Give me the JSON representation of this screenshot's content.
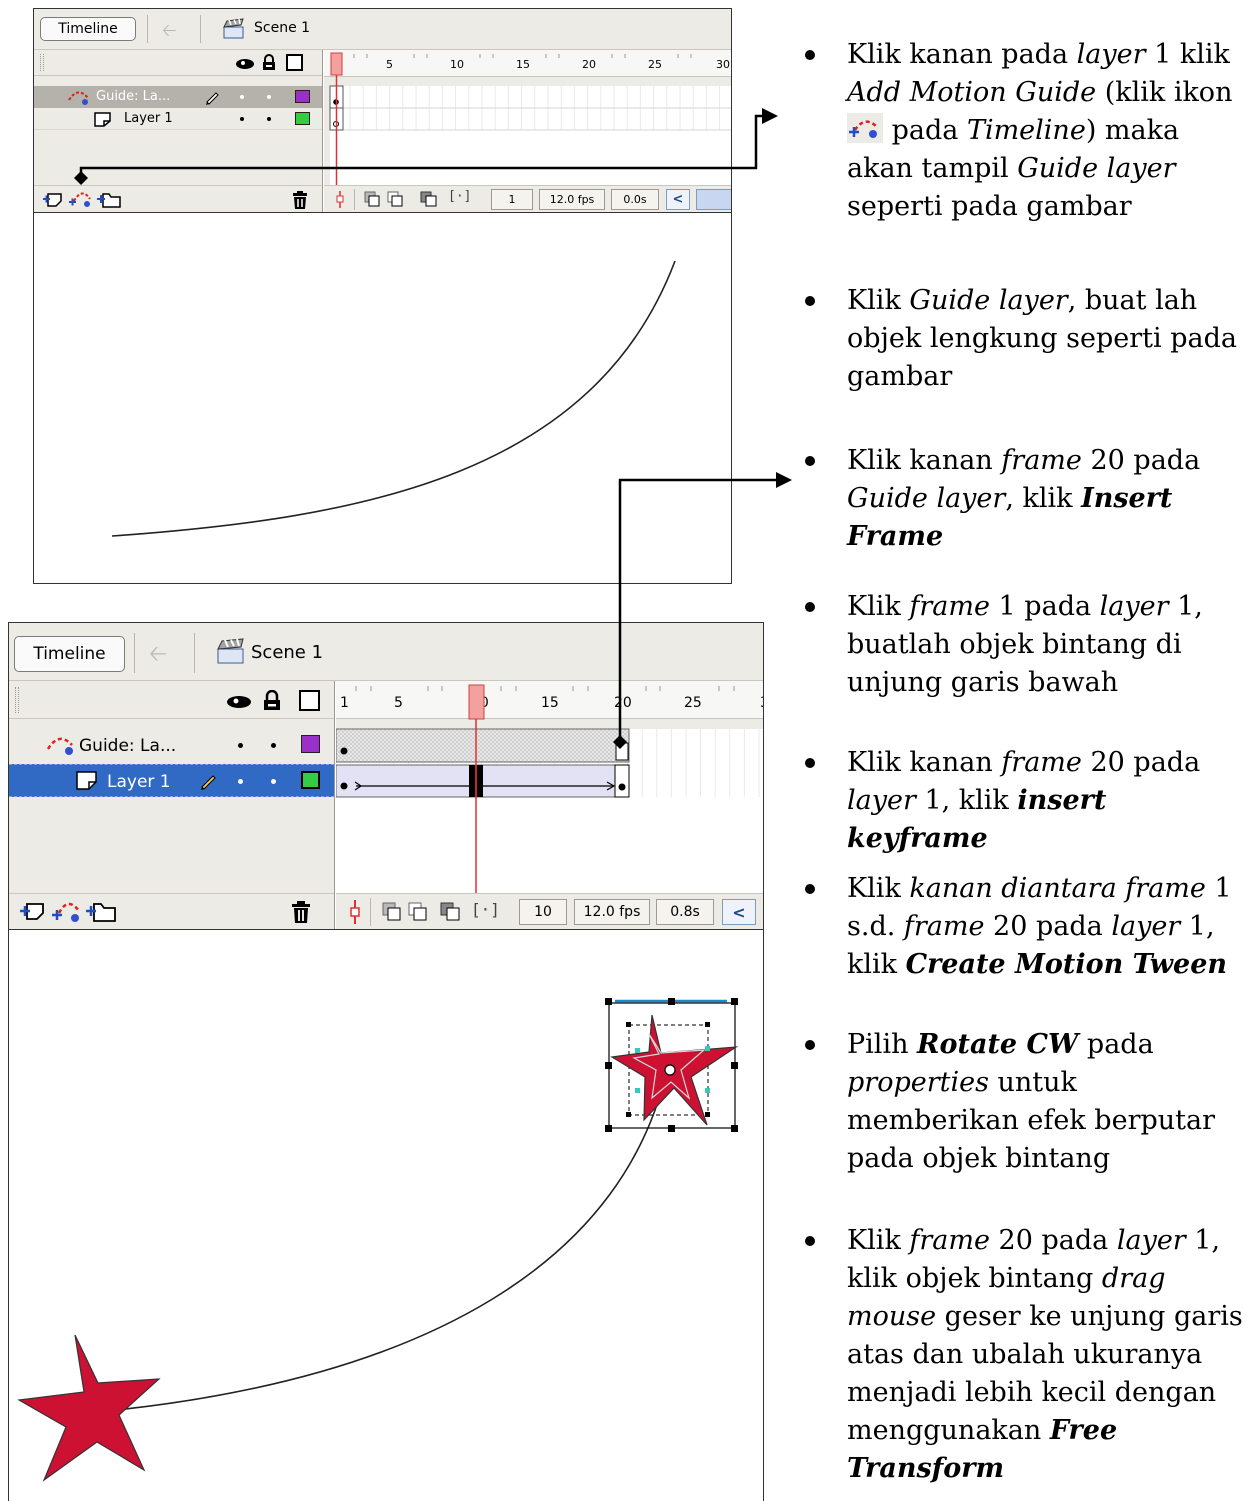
{
  "screenshot1": {
    "tab_label": "Timeline",
    "scene_label": "Scene 1",
    "ruler_numbers": [
      "1",
      "5",
      "10",
      "15",
      "20",
      "25",
      "30"
    ],
    "layers": [
      {
        "name": "Guide: La...",
        "type": "guide",
        "color": "#9b30c9",
        "selected": true
      },
      {
        "name": "Layer 1",
        "type": "normal",
        "color": "#33cc44",
        "selected": false
      }
    ],
    "current_frame": "1",
    "fps": "12.0 fps",
    "elapsed": "0.0s",
    "playhead_frame": 1,
    "total_frames_guide": 1
  },
  "screenshot2": {
    "tab_label": "Timeline",
    "scene_label": "Scene 1",
    "ruler_numbers": [
      "1",
      "5",
      "10",
      "15",
      "20",
      "25",
      "3"
    ],
    "layers": [
      {
        "name": "Guide: La...",
        "type": "guide",
        "color": "#9b30c9",
        "selected": false
      },
      {
        "name": "Layer 1",
        "type": "normal",
        "color": "#33cc44",
        "selected": true
      }
    ],
    "current_frame": "10",
    "fps": "12.0 fps",
    "elapsed": "0.8s",
    "playhead_frame": 10,
    "tween_start_frame": 1,
    "tween_end_frame": 20
  },
  "colors": {
    "star_fill": "#cc1133",
    "playhead": "#e03030",
    "selection_blue": "#316ac5",
    "highlight_gray": "#b4b2aa"
  },
  "icons": [
    "eye-icon",
    "lock-icon",
    "outline-icon",
    "trash-icon",
    "add-layer-icon",
    "add-motion-guide-icon",
    "insert-folder-icon",
    "center-frame-icon",
    "onion-skin-icon",
    "edit-multiple-frames-icon",
    "scene-icon",
    "back-arrow-icon",
    "pencil-icon"
  ],
  "instructions": {
    "i1": {
      "a": "Klik kanan pada ",
      "b": "layer",
      "c": " 1 klik ",
      "d": "Add Motion Guide",
      "e": " (klik ikon ",
      "f": " pada ",
      "g": "Timeline",
      "h": ") maka akan tampil ",
      "i": "Guide layer",
      "j": " seperti pada gambar"
    },
    "i2": {
      "a": "Klik ",
      "b": "Guide layer",
      "c": ", buat lah objek lengkung seperti pada gambar"
    },
    "i3": {
      "a": "Klik kanan ",
      "b": "frame",
      "c": " 20 pada ",
      "d": "Guide layer",
      "e": ", klik ",
      "f": "Insert Frame"
    },
    "i4": {
      "a": "Klik ",
      "b": "frame",
      "c": " 1 pada ",
      "d": "layer",
      "e": " 1, buatlah objek bintang di unjung garis bawah"
    },
    "i5": {
      "a": "Klik kanan ",
      "b": "frame",
      "c": " 20 pada ",
      "d": "layer",
      "e": " 1, klik ",
      "f": "insert keyframe"
    },
    "i6": {
      "a": "Klik ",
      "b": "kanan diantara frame",
      "c": " 1 s.d. ",
      "d": "frame",
      "e": " 20 pada ",
      "f": "layer",
      "g": " 1, klik ",
      "h": "Create Motion Tween"
    },
    "i7": {
      "a": "Pilih ",
      "b": "Rotate CW",
      "c": " pada ",
      "d": "properties",
      "e": " untuk memberikan efek berputar pada objek bintang"
    },
    "i8": {
      "a": "Klik ",
      "b": "frame",
      "c": " 20 pada ",
      "d": "layer",
      "e": " 1, klik objek bintang ",
      "f": "drag mouse",
      "g": " geser ke unjung garis atas dan ubalah ukuranya menjadi lebih kecil dengan menggunakan ",
      "h": "Free Transform"
    }
  }
}
